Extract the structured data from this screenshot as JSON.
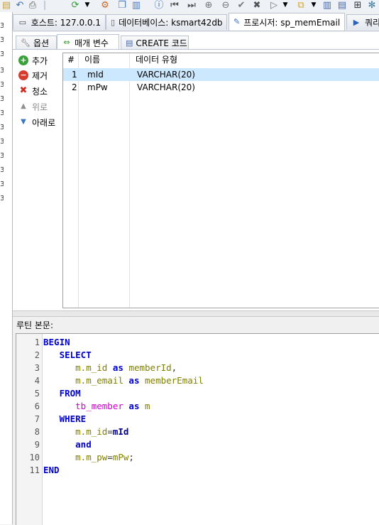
{
  "toolbar": {
    "icons": [
      "document-icon",
      "undo-icon",
      "print-icon",
      "refresh-icon",
      "schema-icon",
      "copy-icon",
      "save-icon",
      "help-icon",
      "first-record-icon",
      "last-record-icon",
      "add-icon",
      "confirm-icon",
      "cancel-icon",
      "run-icon",
      "run-menu-icon",
      "export-icon",
      "save-all-icon",
      "lock-icon",
      "tools-icon"
    ]
  },
  "gutter_numbers": [
    "3",
    "3",
    "3",
    "3",
    "3",
    "3",
    "3",
    "3",
    "3",
    "3",
    "3",
    "3",
    "3",
    "3"
  ],
  "tabs": [
    {
      "label": "호스트: 127.0.0.1",
      "icon": "monitor-icon"
    },
    {
      "label": "데이터베이스: ksmart42db",
      "icon": "database-icon"
    },
    {
      "label": "프로시저: sp_memEmail",
      "icon": "procedure-icon"
    },
    {
      "label": "쿼리",
      "icon": "play-icon"
    }
  ],
  "subtabs": [
    {
      "label": "옵션",
      "icon": "wrench-icon"
    },
    {
      "label": "매개 변수",
      "icon": "parameters-icon"
    },
    {
      "label": "CREATE 코드",
      "icon": "code-icon"
    }
  ],
  "side_buttons": [
    {
      "label": "추가",
      "icon": "plus-icon",
      "enabled": true
    },
    {
      "label": "제거",
      "icon": "minus-icon",
      "enabled": true
    },
    {
      "label": "청소",
      "icon": "clear-icon",
      "enabled": true
    },
    {
      "label": "위로",
      "icon": "up-arrow-icon",
      "enabled": false
    },
    {
      "label": "아래로",
      "icon": "down-arrow-icon",
      "enabled": true
    }
  ],
  "grid": {
    "headers": {
      "num": "#",
      "name": "이름",
      "type": "데이터 유형"
    },
    "rows": [
      {
        "num": "1",
        "name": "mId",
        "type": "VARCHAR(20)",
        "selected": true
      },
      {
        "num": "2",
        "name": "mPw",
        "type": "VARCHAR(20)",
        "selected": false
      }
    ]
  },
  "routine_body_label": "루틴 본문:",
  "code": {
    "line_numbers": [
      "1",
      "2",
      "3",
      "4",
      "5",
      "6",
      "7",
      "8",
      "9",
      "10",
      "11"
    ],
    "l1": {
      "kw": "BEGIN"
    },
    "l2": {
      "kw": "SELECT"
    },
    "l3": {
      "a": "m.m_id",
      "kw": "as",
      "b": "memberId",
      "c": ","
    },
    "l4": {
      "a": "m.m_email",
      "kw": "as",
      "b": "memberEmail"
    },
    "l5": {
      "kw": "FROM"
    },
    "l6": {
      "a": "tb_member",
      "kw": "as",
      "b": "m"
    },
    "l7": {
      "kw": "WHERE"
    },
    "l8": {
      "a": "m.m_id",
      "op": "=",
      "b": "mId"
    },
    "l9": {
      "kw": "and"
    },
    "l10": {
      "a": "m.m_pw",
      "op": "=",
      "b": "mPw",
      "c": ";"
    },
    "l11": {
      "kw": "END"
    }
  },
  "colors": {
    "keyword": "#0000cc",
    "identifier": "#808000",
    "table": "#cc00cc",
    "selection": "#cce8ff"
  }
}
